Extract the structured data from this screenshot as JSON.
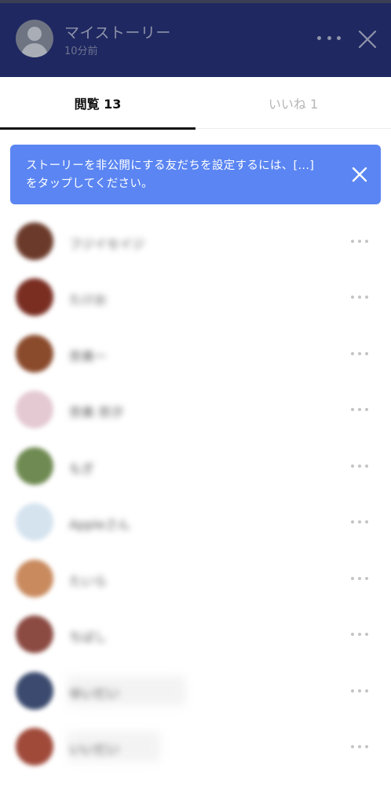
{
  "header": {
    "title": "マイストーリー",
    "subtitle": "10分前",
    "icons": [
      "avatar-icon",
      "more-icon",
      "close-icon"
    ]
  },
  "tabs": [
    {
      "label": "閲覧 13",
      "active": true
    },
    {
      "label": "いいね 1",
      "active": false
    }
  ],
  "notice": {
    "message": "ストーリーを非公開にする友だちを設定するには、[...]をタップしてください。"
  },
  "viewers": [
    {
      "name": "フジイセイジ",
      "avatar_color": "#6b3a2a"
    },
    {
      "name": "たけお",
      "avatar_color": "#7a2e22"
    },
    {
      "name": "奈美ー",
      "avatar_color": "#8a4a2c"
    },
    {
      "name": "奈美 奈汐",
      "avatar_color": "#e4c9d3"
    },
    {
      "name": "もぎ",
      "avatar_color": "#6f8a52"
    },
    {
      "name": "Appleさん",
      "avatar_color": "#d5e3ef"
    },
    {
      "name": "たいら",
      "avatar_color": "#c98a5e"
    },
    {
      "name": "ちばし",
      "avatar_color": "#8b4a42"
    },
    {
      "name": "ゆいだい",
      "avatar_color": "#3b4a6e"
    },
    {
      "name": "いいだい",
      "avatar_color": "#a04a3a"
    }
  ],
  "colors": {
    "header_bg": "#1f2861",
    "notice_bg": "#5a85f2",
    "tab_active": "#111111",
    "tab_inactive": "#b5b5b5"
  }
}
